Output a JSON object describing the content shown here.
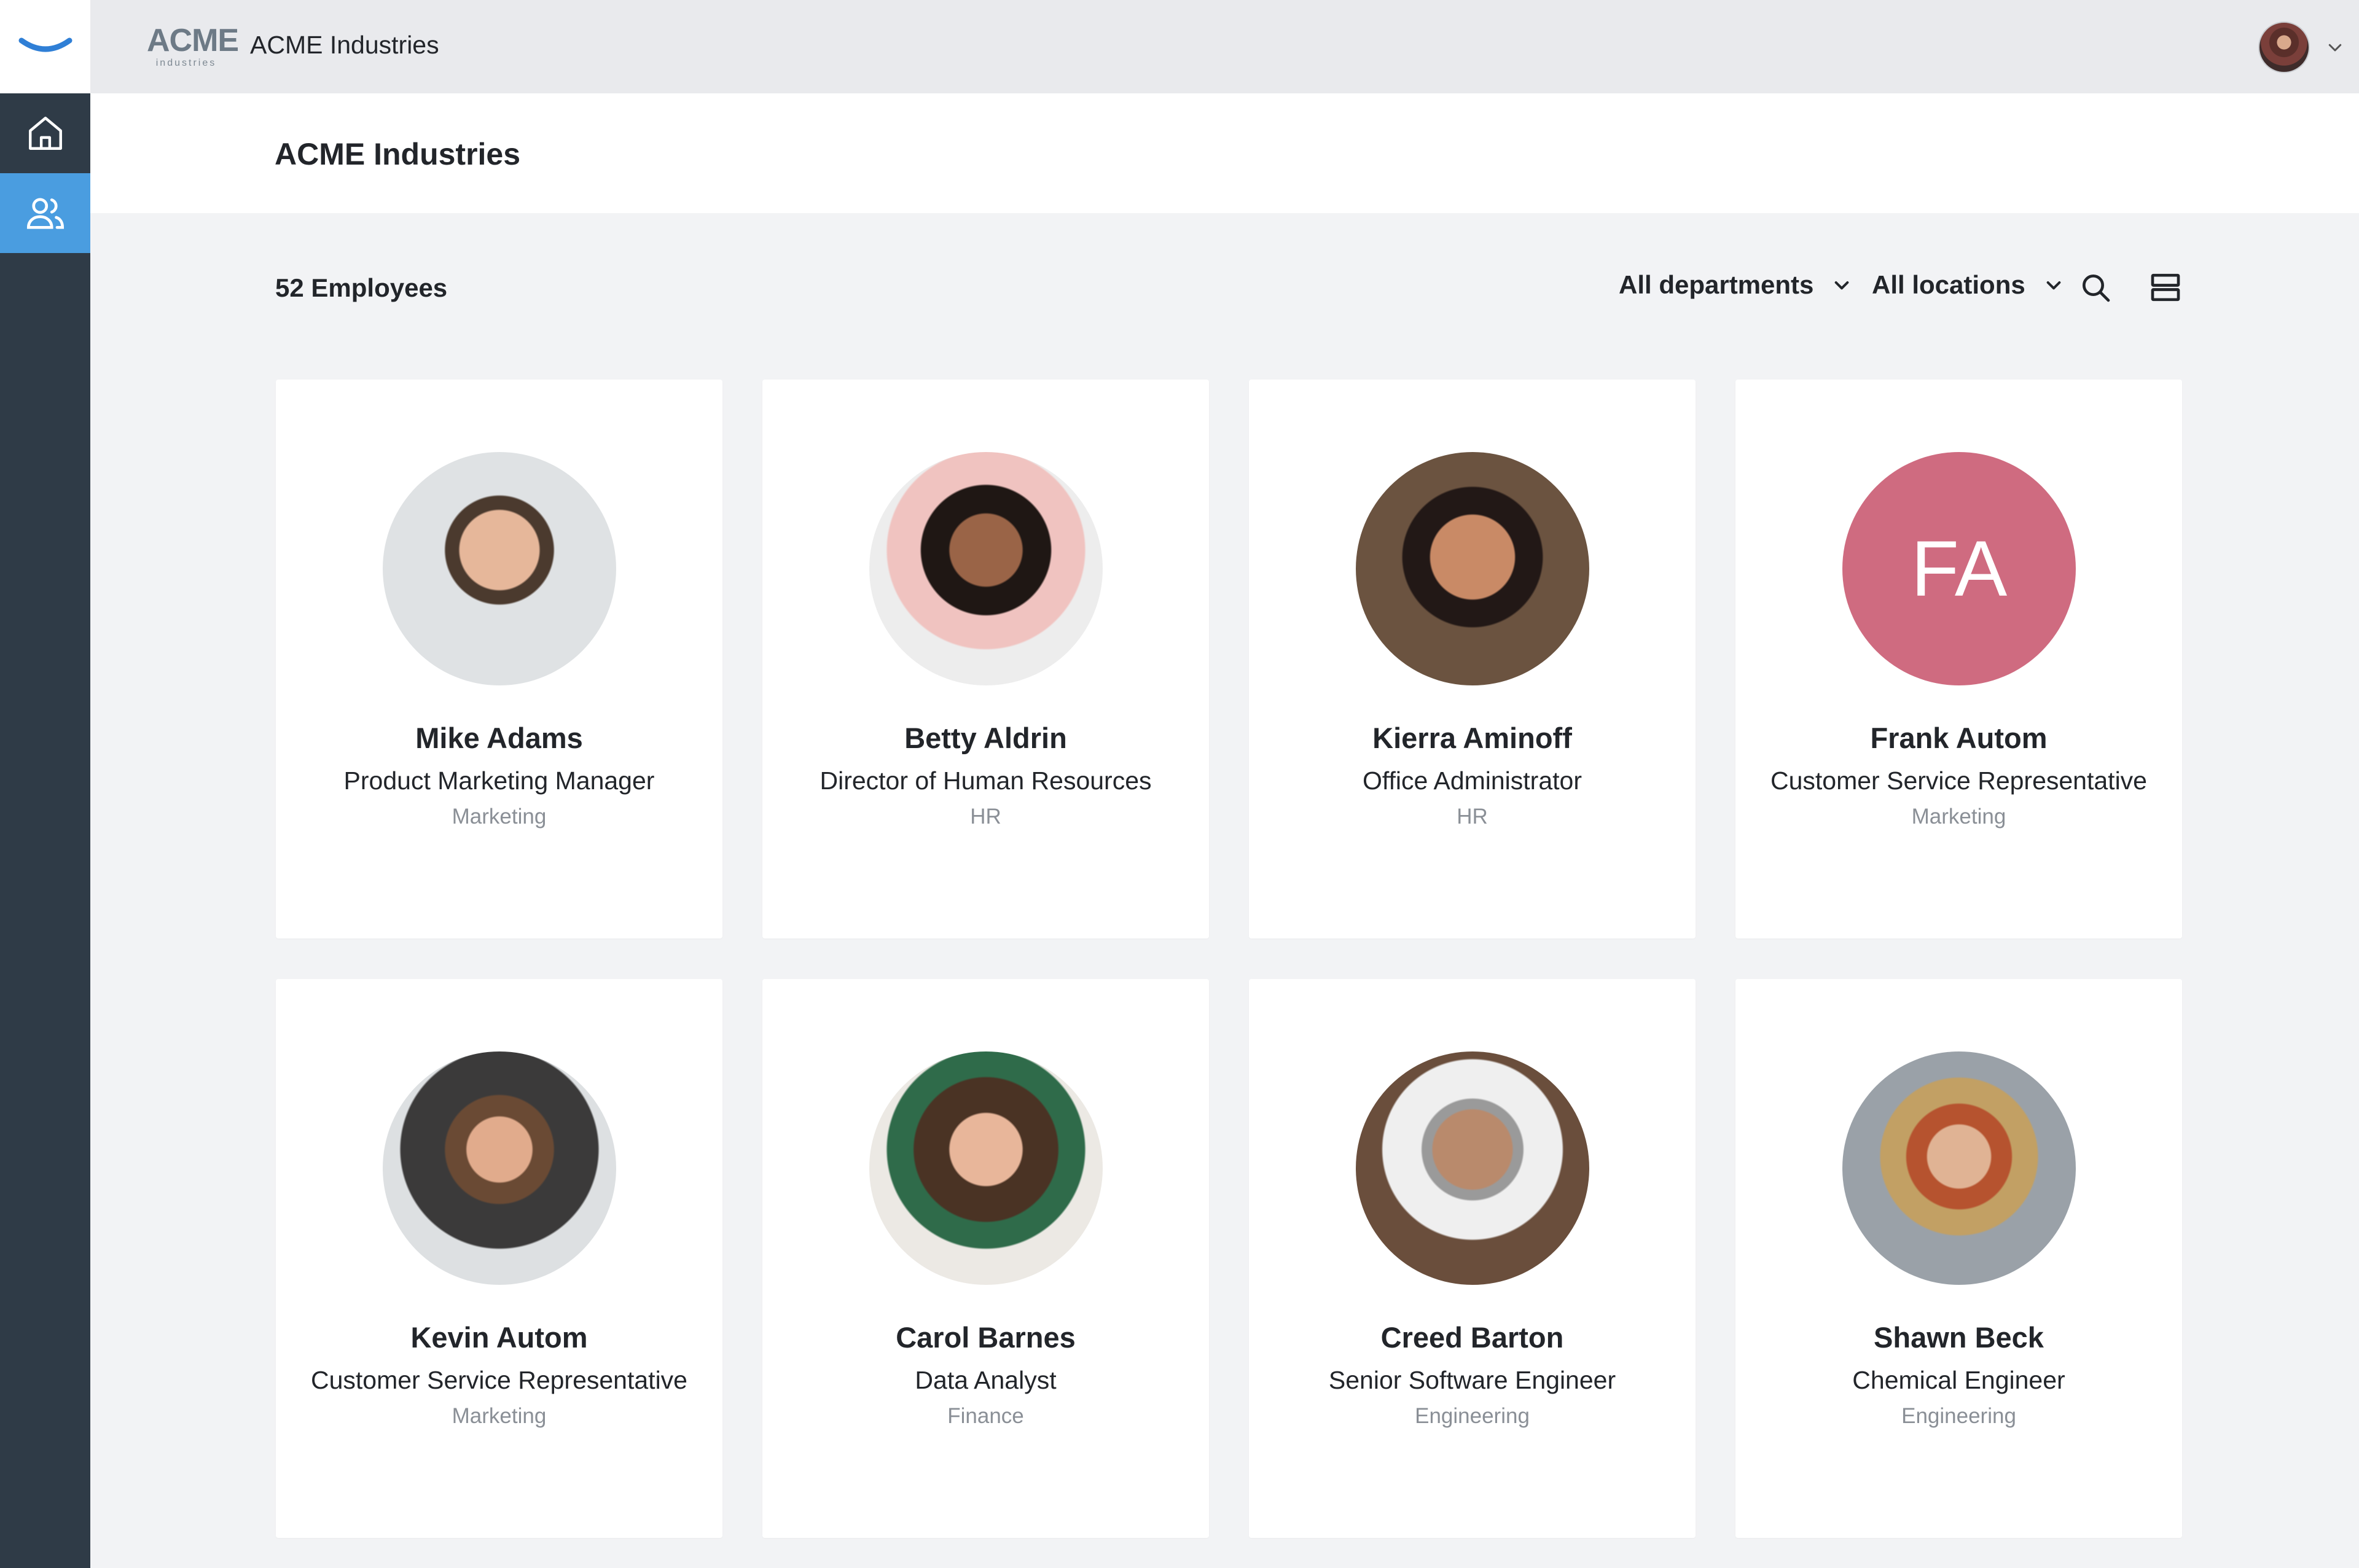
{
  "topbar": {
    "logo_text": "ACME",
    "logo_subtext": "industries",
    "company_name": "ACME Industries"
  },
  "nav": {
    "items": [
      {
        "icon": "home-icon"
      },
      {
        "icon": "people-icon",
        "active": true
      }
    ]
  },
  "page": {
    "title": "ACME Industries"
  },
  "toolbar": {
    "count_label": "52 Employees",
    "department_filter": "All departments",
    "location_filter": "All locations",
    "search_icon": "search-icon",
    "layout_icon": "list-layout-icon"
  },
  "colors": {
    "rail": "#2f3b47",
    "accent": "#4a9de0",
    "initials_bg": "#cf6b80"
  },
  "employees": [
    {
      "name": "Mike Adams",
      "role": "Product Marketing Manager",
      "department": "Marketing"
    },
    {
      "name": "Betty Aldrin",
      "role": "Director of Human Resources",
      "department": "HR"
    },
    {
      "name": "Kierra Aminoff",
      "role": "Office Administrator",
      "department": "HR"
    },
    {
      "name": "Frank Autom",
      "role": "Customer Service Representative",
      "department": "Marketing",
      "initials": "FA"
    },
    {
      "name": "Kevin Autom",
      "role": "Customer Service Representative",
      "department": "Marketing"
    },
    {
      "name": "Carol Barnes",
      "role": "Data Analyst",
      "department": "Finance"
    },
    {
      "name": "Creed Barton",
      "role": "Senior Software Engineer",
      "department": "Engineering"
    },
    {
      "name": "Shawn Beck",
      "role": "Chemical Engineer",
      "department": "Engineering"
    }
  ]
}
